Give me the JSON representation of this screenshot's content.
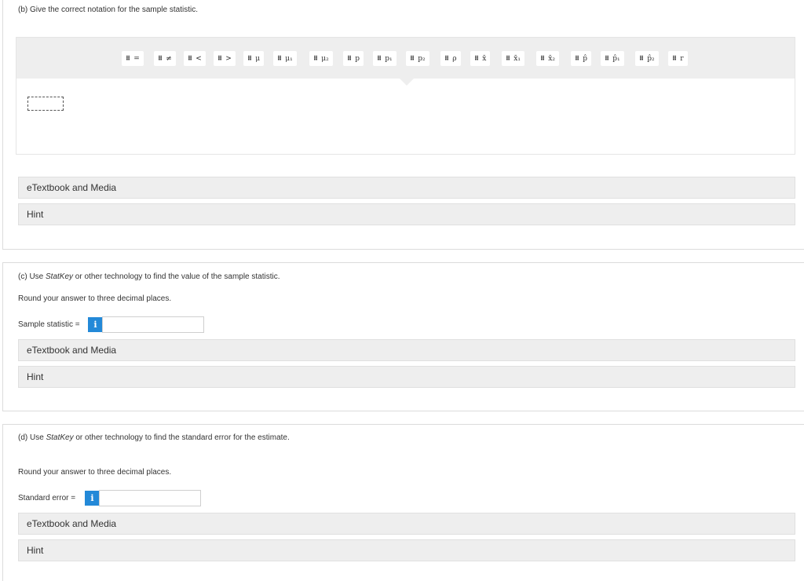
{
  "part_b": {
    "question": "(b) Give the correct notation for the sample statistic.",
    "tokens": [
      "=",
      "≠",
      "<",
      ">",
      "μ",
      "μ₁",
      "μ₂",
      "p",
      "p₁",
      "p₂",
      "ρ",
      "x̄",
      "x̄₁",
      "x̄₂",
      "p̂",
      "p̂₁",
      "p̂₂",
      "r"
    ],
    "etextbook": "eTextbook and Media",
    "hint": "Hint"
  },
  "part_c": {
    "question_prefix": "(c) Use ",
    "question_statkey": "StatKey",
    "question_suffix": " or other technology to find the value of the sample statistic.",
    "round_note": "Round your answer to three decimal places.",
    "field_label": "Sample statistic =",
    "info_glyph": "i",
    "input_value": "",
    "etextbook": "eTextbook and Media",
    "hint": "Hint"
  },
  "part_d": {
    "question_prefix": "(d) Use ",
    "question_statkey": "StatKey",
    "question_suffix": " or other technology to find the standard error for the estimate.",
    "round_note": "Round your answer to three decimal places.",
    "field_label": "Standard error =",
    "info_glyph": "i",
    "input_value": "",
    "etextbook": "eTextbook and Media",
    "hint": "Hint"
  },
  "colors": {
    "info_button": "#2389d8",
    "bar_background": "#eeeeee"
  }
}
